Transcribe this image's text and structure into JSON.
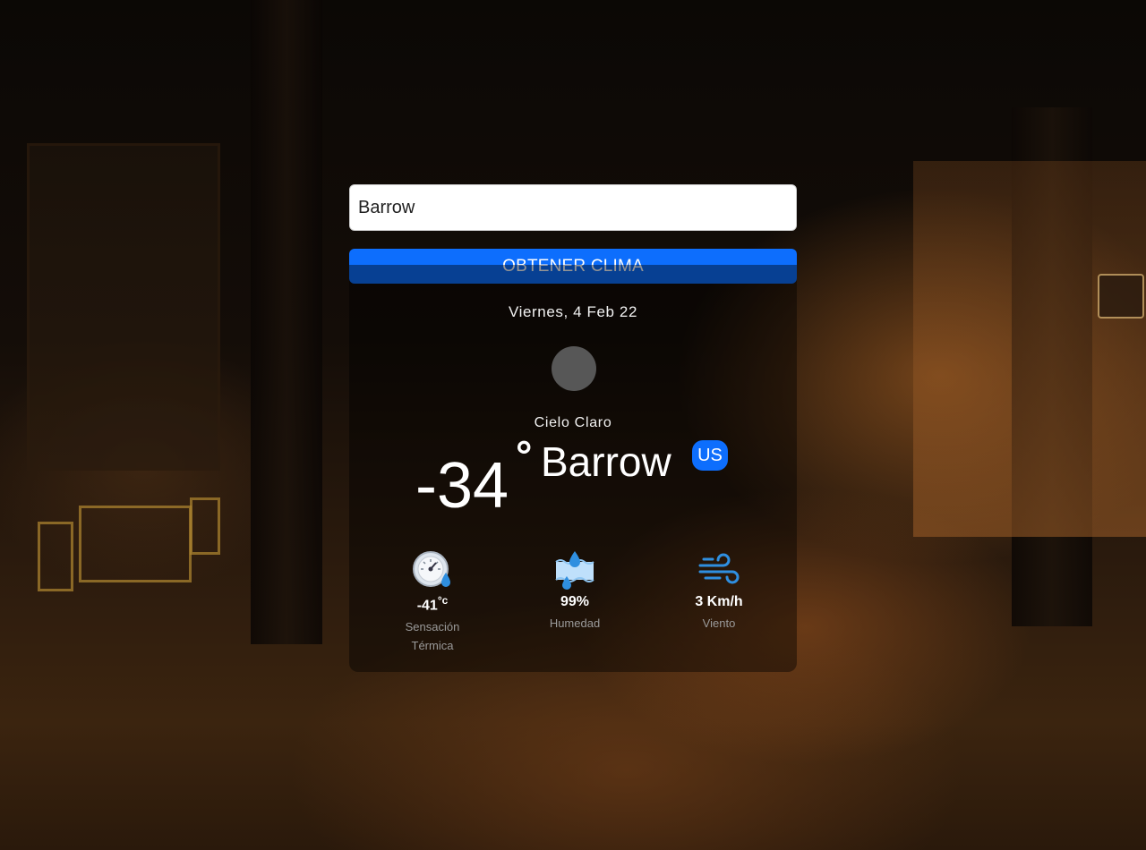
{
  "search": {
    "value": "Barrow",
    "placeholder": ""
  },
  "button": {
    "label": "OBTENER CLIMA"
  },
  "weather": {
    "date": "Viernes, 4 Feb 22",
    "icon": "weather-icon-placeholder",
    "description": "Cielo Claro",
    "temperature": "-34",
    "degree_symbol": "°",
    "city": "Barrow",
    "country": "US"
  },
  "stats": {
    "feels_like": {
      "value": "-41",
      "unit": "°c",
      "label": "Sensación Térmica",
      "icon": "thermometer-gauge-icon"
    },
    "humidity": {
      "value": "99%",
      "label": "Humedad",
      "icon": "humidity-icon"
    },
    "wind": {
      "value": "3 Km/h",
      "label": "Viento",
      "icon": "wind-icon"
    }
  },
  "colors": {
    "accent": "#0d6efd",
    "card_bg": "rgba(0,0,0,0.42)",
    "label_gray": "#9a9a9a"
  }
}
